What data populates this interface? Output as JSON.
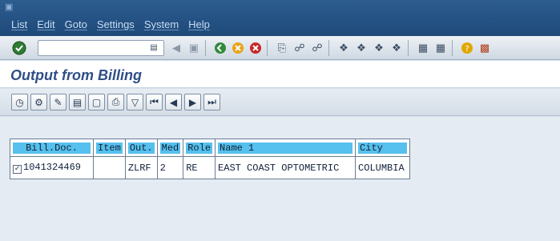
{
  "menu": {
    "items": [
      "List",
      "Edit",
      "Goto",
      "Settings",
      "System",
      "Help"
    ]
  },
  "toolbar": {
    "command_value": "",
    "icons": [
      "enter-icon",
      "save-icon",
      "back-icon",
      "exit-icon",
      "cancel-icon",
      "print-icon",
      "find-icon",
      "find-next-icon",
      "first-page-icon",
      "previous-page-icon",
      "next-page-icon",
      "last-page-icon",
      "create-session-icon",
      "shortcut-icon",
      "help-icon",
      "customize-layout-icon"
    ]
  },
  "page": {
    "title": "Output from Billing"
  },
  "app_toolbar": {
    "icons": [
      "refresh-icon",
      "processing-log-icon",
      "display-output-icon",
      "print-preview-icon",
      "details-icon",
      "printer-icon",
      "filter-icon",
      "first-icon",
      "previous-icon",
      "next-icon",
      "last-icon"
    ]
  },
  "table": {
    "columns": [
      "Bill.Doc.",
      "Item",
      "Out.",
      "Med",
      "Role",
      "Name 1",
      "City"
    ],
    "rows": [
      {
        "checked": true,
        "bill_doc": "1041324469",
        "item": "",
        "out": "ZLRF",
        "med": "2",
        "role": "RE",
        "name1": "EAST COAST OPTOMETRIC",
        "city": "COLUMBIA"
      }
    ]
  }
}
